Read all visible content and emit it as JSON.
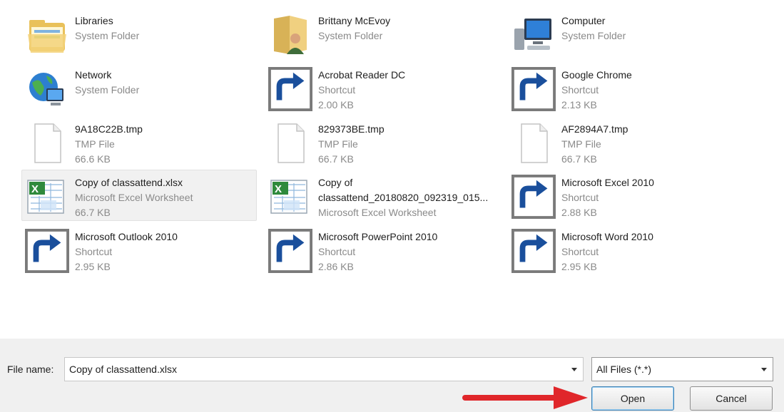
{
  "files": [
    {
      "name": "Libraries",
      "type": "System Folder",
      "size": "",
      "icon": "libraries-folder-icon",
      "shortcut": false,
      "selected": false
    },
    {
      "name": "Brittany McEvoy",
      "type": "System Folder",
      "size": "",
      "icon": "user-folder-icon",
      "shortcut": false,
      "selected": false
    },
    {
      "name": "Computer",
      "type": "System Folder",
      "size": "",
      "icon": "computer-icon",
      "shortcut": false,
      "selected": false
    },
    {
      "name": "Network",
      "type": "System Folder",
      "size": "",
      "icon": "network-icon",
      "shortcut": false,
      "selected": false
    },
    {
      "name": "Acrobat Reader DC",
      "type": "Shortcut",
      "size": "2.00 KB",
      "icon": "acrobat-icon",
      "shortcut": true,
      "selected": false
    },
    {
      "name": "Google Chrome",
      "type": "Shortcut",
      "size": "2.13 KB",
      "icon": "chrome-icon",
      "shortcut": true,
      "selected": false
    },
    {
      "name": "9A18C22B.tmp",
      "type": "TMP File",
      "size": "66.6 KB",
      "icon": "blank-file-icon",
      "shortcut": false,
      "selected": false
    },
    {
      "name": "829373BE.tmp",
      "type": "TMP File",
      "size": "66.7 KB",
      "icon": "blank-file-icon",
      "shortcut": false,
      "selected": false
    },
    {
      "name": "AF2894A7.tmp",
      "type": "TMP File",
      "size": "66.7 KB",
      "icon": "blank-file-icon",
      "shortcut": false,
      "selected": false
    },
    {
      "name": "Copy of classattend.xlsx",
      "type": "Microsoft Excel Worksheet",
      "size": "66.7 KB",
      "icon": "excel-worksheet-icon",
      "shortcut": false,
      "selected": true
    },
    {
      "name": "Copy of",
      "name2": "classattend_20180820_092319_015...",
      "type": "Microsoft Excel Worksheet",
      "size": "",
      "icon": "excel-worksheet-icon",
      "shortcut": false,
      "selected": false
    },
    {
      "name": "Microsoft Excel 2010",
      "type": "Shortcut",
      "size": "2.88 KB",
      "icon": "excel-app-icon",
      "shortcut": true,
      "selected": false
    },
    {
      "name": "Microsoft Outlook 2010",
      "type": "Shortcut",
      "size": "2.95 KB",
      "icon": "outlook-app-icon",
      "shortcut": true,
      "selected": false
    },
    {
      "name": "Microsoft PowerPoint 2010",
      "type": "Shortcut",
      "size": "2.86 KB",
      "icon": "powerpoint-app-icon",
      "shortcut": true,
      "selected": false
    },
    {
      "name": "Microsoft Word 2010",
      "type": "Shortcut",
      "size": "2.95 KB",
      "icon": "word-app-icon",
      "shortcut": true,
      "selected": false
    }
  ],
  "footer": {
    "filename_label": "File name:",
    "filename_value": "Copy of classattend.xlsx",
    "filetype_value": "All Files (*.*)",
    "open_label": "Open",
    "cancel_label": "Cancel"
  },
  "colors": {
    "annotation_arrow": "#e0262a",
    "selection": "#f1f1f1",
    "dialog_footer": "#f0f0f0"
  }
}
